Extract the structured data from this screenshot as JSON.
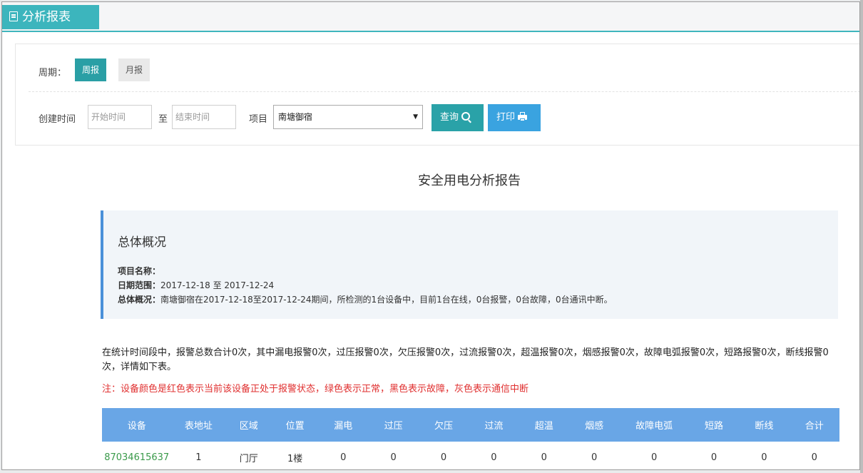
{
  "tab": {
    "title": "分析报表"
  },
  "filters": {
    "period_label": "周期：",
    "week_button": "周报",
    "month_button": "月报",
    "created_label": "创建时间",
    "start_placeholder": "开始时间",
    "to_label": "至",
    "end_placeholder": "结束时间",
    "project_label": "项目",
    "project_value": "南塘御宿",
    "query_button": "查询",
    "print_button": "打印"
  },
  "report": {
    "title": "安全用电分析报告",
    "summary": {
      "heading": "总体概况",
      "project_name_label": "项目名称：",
      "project_name_value": "",
      "date_range_label": "日期范围：",
      "date_range_value": "2017-12-18 至 2017-12-24",
      "overview_label": "总体概况：",
      "overview_value": "南塘御宿在2017-12-18至2017-12-24期间，所检测的1台设备中，目前1台在线，0台报警，0台故障，0台通讯中断。"
    },
    "statistics_text": "在统计时间段中，报警总数合计0次，其中漏电报警0次，过压报警0次，欠压报警0次，过流报警0次，超温报警0次，烟感报警0次，故障电弧报警0次，短路报警0次，断线报警0次，详情如下表。",
    "note_text": "注：设备颜色是红色表示当前该设备正处于报警状态，绿色表示正常，黑色表示故障，灰色表示通信中断",
    "table": {
      "headers": [
        "设备",
        "表地址",
        "区域",
        "位置",
        "漏电",
        "过压",
        "欠压",
        "过流",
        "超温",
        "烟感",
        "故障电弧",
        "短路",
        "断线",
        "合计"
      ],
      "rows": [
        [
          "87034615637",
          "1",
          "门厅",
          "1楼",
          "0",
          "0",
          "0",
          "0",
          "0",
          "0",
          "0",
          "0",
          "0",
          "0"
        ]
      ]
    }
  },
  "colors": {
    "tab": "#3cb5bd",
    "query_button": "#2aa2a8",
    "print_button": "#3aa3e0",
    "table_header": "#69a6e6",
    "device_normal": "#3a9a4a",
    "note": "#e03030"
  }
}
